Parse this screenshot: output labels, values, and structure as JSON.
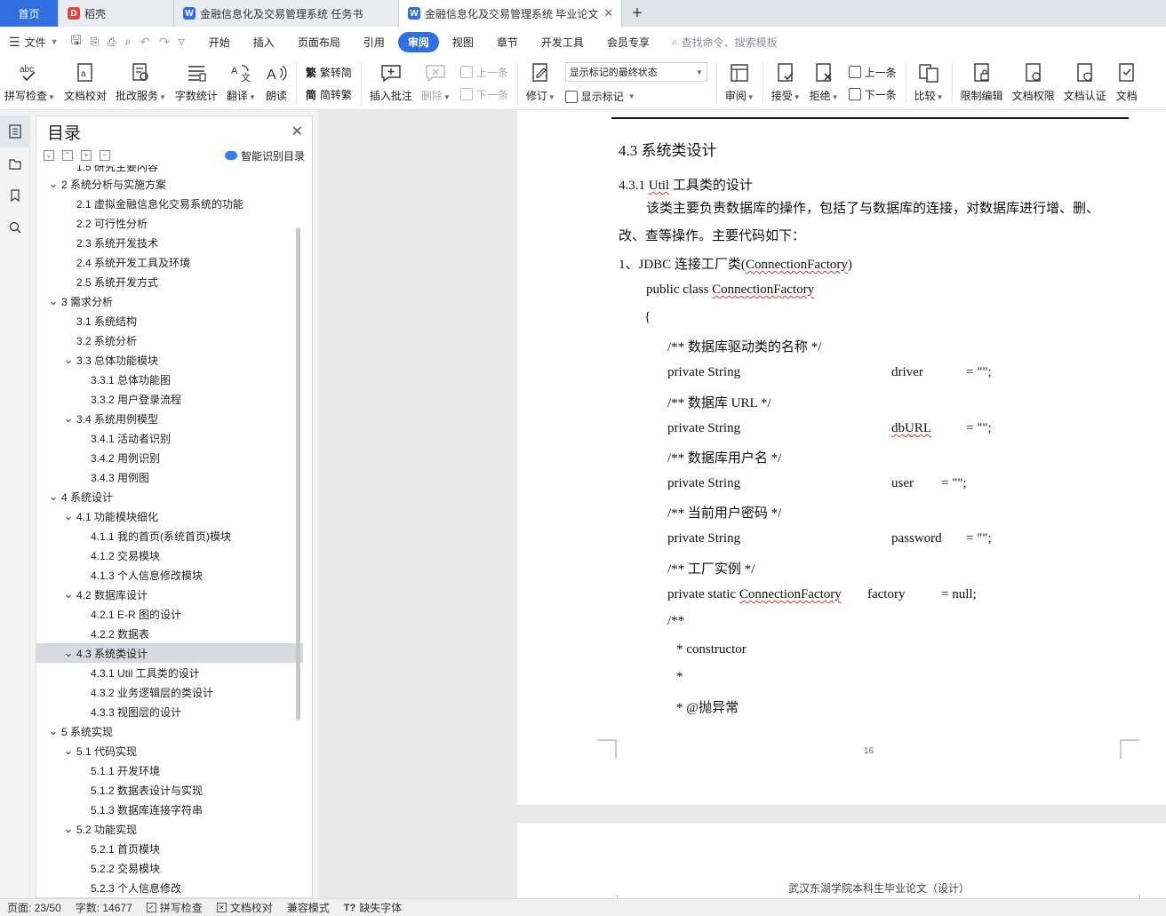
{
  "tabs": {
    "home": "首页",
    "daoke": "稻壳",
    "task": "金融信息化及交易管理系统 任务书",
    "thesis": "金融信息化及交易管理系统 毕业论文"
  },
  "menu": {
    "file": "文件",
    "tabs": [
      "开始",
      "插入",
      "页面布局",
      "引用",
      "审阅",
      "视图",
      "章节",
      "开发工具",
      "会员专享"
    ],
    "active": "审阅",
    "search": "查找命令、搜索模板"
  },
  "ribbon": {
    "spell_check": "拼写检查",
    "doc_proof": "文档校对",
    "batch_service": "批改服务",
    "word_count": "字数统计",
    "translate": "翻译",
    "read_aloud": "朗读",
    "trad_to_simp": "繁转简",
    "simp_to_trad": "简转繁",
    "insert_comment": "插入批注",
    "delete": "删除",
    "prev_comment": "上一条",
    "next_comment": "下一条",
    "track_changes": "修订",
    "markup_state": "显示标记的最终状态",
    "show_markup": "显示标记",
    "review": "审阅",
    "accept": "接受",
    "reject": "拒绝",
    "prev_change": "上一条",
    "next_change": "下一条",
    "compare": "比较",
    "restrict_edit": "限制编辑",
    "doc_permission": "文档权限",
    "doc_certify": "文档认证",
    "doc_more": "文档"
  },
  "toc": {
    "title": "目录",
    "smart": "智能识别目录",
    "items": [
      {
        "level": 2,
        "text": "1.5  研究主要内容",
        "arrow": false,
        "cut": true
      },
      {
        "level": 1,
        "text": "2  系统分析与实施方案",
        "arrow": true
      },
      {
        "level": 2,
        "text": "2.1  虚拟金融信息化交易系统的功能",
        "arrow": false
      },
      {
        "level": 2,
        "text": "2.2  可行性分析",
        "arrow": false
      },
      {
        "level": 2,
        "text": "2.3  系统开发技术",
        "arrow": false
      },
      {
        "level": 2,
        "text": "2.4  系统开发工具及环境",
        "arrow": false
      },
      {
        "level": 2,
        "text": "2.5  系统开发方式",
        "arrow": false
      },
      {
        "level": 1,
        "text": "3  需求分析",
        "arrow": true
      },
      {
        "level": 2,
        "text": "3.1  系统结构",
        "arrow": false
      },
      {
        "level": 2,
        "text": "3.2  系统分析",
        "arrow": false
      },
      {
        "level": 2,
        "text": "3.3  总体功能模块",
        "arrow": true
      },
      {
        "level": 3,
        "text": "3.3.1  总体功能图",
        "arrow": false
      },
      {
        "level": 3,
        "text": "3.3.2  用户登录流程",
        "arrow": false
      },
      {
        "level": 2,
        "text": "3.4  系统用例模型",
        "arrow": true
      },
      {
        "level": 3,
        "text": "3.4.1  活动者识别",
        "arrow": false
      },
      {
        "level": 3,
        "text": "3.4.2  用例识别",
        "arrow": false
      },
      {
        "level": 3,
        "text": "3.4.3  用例图",
        "arrow": false
      },
      {
        "level": 1,
        "text": "4  系统设计",
        "arrow": true
      },
      {
        "level": 2,
        "text": "4.1  功能模块细化",
        "arrow": true
      },
      {
        "level": 3,
        "text": "4.1.1  我的首页(系统首页)模块",
        "arrow": false
      },
      {
        "level": 3,
        "text": "4.1.2  交易模块",
        "arrow": false
      },
      {
        "level": 3,
        "text": "4.1.3  个人信息修改模块",
        "arrow": false
      },
      {
        "level": 2,
        "text": "4.2  数据库设计",
        "arrow": true
      },
      {
        "level": 3,
        "text": "4.2.1 E-R 图的设计",
        "arrow": false
      },
      {
        "level": 3,
        "text": "4.2.2  数据表",
        "arrow": false
      },
      {
        "level": 2,
        "text": "4.3  系统类设计",
        "arrow": true,
        "selected": true
      },
      {
        "level": 3,
        "text": "4.3.1 Util 工具类的设计",
        "arrow": false
      },
      {
        "level": 3,
        "text": "4.3.2  业务逻辑层的类设计",
        "arrow": false
      },
      {
        "level": 3,
        "text": "4.3.3  视图层的设计",
        "arrow": false
      },
      {
        "level": 1,
        "text": "5  系统实现",
        "arrow": true
      },
      {
        "level": 2,
        "text": "5.1 代码实现",
        "arrow": true
      },
      {
        "level": 3,
        "text": "5.1.1 开发环境",
        "arrow": false
      },
      {
        "level": 3,
        "text": "5.1.2  数据表设计与实现",
        "arrow": false
      },
      {
        "level": 3,
        "text": "5.1.3  数据库连接字符串",
        "arrow": false
      },
      {
        "level": 2,
        "text": "5.2  功能实现",
        "arrow": true
      },
      {
        "level": 3,
        "text": "5.2.1  首页模块",
        "arrow": false
      },
      {
        "level": 3,
        "text": "5.2.2  交易模块",
        "arrow": false
      },
      {
        "level": 3,
        "text": "5.2.3  个人信息修改",
        "arrow": false,
        "cut": true
      }
    ]
  },
  "document": {
    "section_title": "4.3  系统类设计",
    "subsection_prefix": "4.3.1 ",
    "subsection_util": "Util",
    "subsection_rest": " 工具类的设计",
    "para1_line1": "该类主要负责数据库的操作，包括了与数据库的连接，对数据库进行增、删、",
    "para1_line2": "改、查等操作。主要代码如下：",
    "item1_prefix": "1、JDBC 连接工厂类(",
    "item1_class": "ConnectionFactory",
    "item1_suffix": ")",
    "code_class_prefix": "public class ",
    "code_class_name": "ConnectionFactory",
    "brace": "{",
    "c_driver_comment": "/**  数据库驱动类的名称  */",
    "c_driver_decl": "private String",
    "c_driver_name": "driver",
    "c_driver_val": "= \"\";",
    "c_url_comment": "/**  数据库 URL */",
    "c_url_decl": "private String",
    "c_url_name": "dbURL",
    "c_url_val": "= \"\";",
    "c_user_comment": "/**  数据库用户名  */",
    "c_user_decl": "private String",
    "c_user_name": "user",
    "c_user_val": "= \"\";",
    "c_pwd_comment": "/**  当前用户密码  */",
    "c_pwd_decl": "private String",
    "c_pwd_name": "password",
    "c_pwd_val": "= \"\";",
    "c_fac_comment": "/**  工厂实例  */",
    "c_fac_decl_prefix": "private static ",
    "c_fac_decl_class": "ConnectionFactory",
    "c_fac_name": "factory",
    "c_fac_val": "= null;",
    "c_doc_open": "/**",
    "c_doc_ctor": "* constructor",
    "c_doc_star": "*",
    "c_doc_throws": "* @抛异常",
    "page_number": "16",
    "next_footer": "武汉东湖学院本科生毕业论文（设计）"
  },
  "status": {
    "page": "页面: 23/50",
    "words": "字数: 14677",
    "spell": "拼写检查",
    "proof": "文档校对",
    "compat": "兼容模式",
    "missing_font": "缺失字体"
  },
  "colors": {
    "accent": "#2f6fe0",
    "wps_red": "#e2473b",
    "spell_underline": "#d33"
  }
}
